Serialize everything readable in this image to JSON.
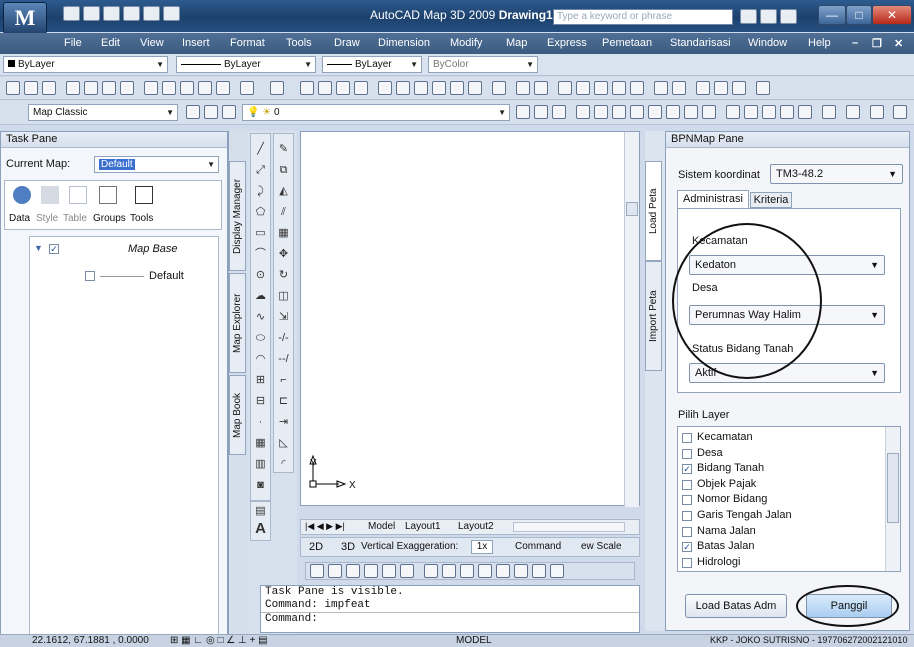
{
  "app": {
    "logo": "M",
    "title": "AutoCAD Map 3D 2009",
    "doc": "Drawing1.dwg",
    "search_placeholder": "Type a keyword or phrase"
  },
  "menu": [
    "File",
    "Edit",
    "View",
    "Insert",
    "Format",
    "Tools",
    "Draw",
    "Dimension",
    "Modify",
    "Map",
    "Express",
    "Pemetaan",
    "Standarisasi",
    "Window",
    "Help"
  ],
  "props": {
    "layer": "ByLayer",
    "linetype": "ByLayer",
    "lineweight": "ByLayer",
    "color": "ByColor"
  },
  "workspace": {
    "name": "Map Classic",
    "layer_current": "0"
  },
  "task_pane": {
    "title": "Task Pane",
    "current_map_label": "Current Map:",
    "current_map_value": "Default",
    "tools": [
      "Data",
      "Style",
      "Table",
      "Groups",
      "Tools"
    ],
    "tree_root": "Map Base",
    "tree_child": "Default",
    "side_tabs": [
      "Display Manager",
      "Map Explorer",
      "Map Book"
    ]
  },
  "layout_tabs": [
    "Model",
    "Layout1",
    "Layout2"
  ],
  "status_row": {
    "btn_2d": "2D",
    "btn_3d": "3D",
    "vert": "Vertical Exaggeration:",
    "vert_val": "1x",
    "command": "Command",
    "scale": "ew Scale"
  },
  "command_lines": [
    "Task Pane is visible.",
    "Command: impfeat",
    "Command:"
  ],
  "statusbar": {
    "coords": "22.1612, 67.1881 , 0.0000",
    "model": "MODEL",
    "user": "KKP - JOKO SUTRISNO - 197706272002121010"
  },
  "ucs": {
    "x": "X",
    "y": "Y"
  },
  "bpn": {
    "title": "BPNMap Pane",
    "side_tabs": [
      "Load Peta",
      "Import Peta"
    ],
    "sistem_label": "Sistem koordinat",
    "sistem_value": "TM3-48.2",
    "tabs": [
      "Administrasi",
      "Kriteria"
    ],
    "kecamatan_label": "Kecamatan",
    "kecamatan_value": "Kedaton",
    "desa_label": "Desa",
    "desa_value": "Perumnas Way Halim",
    "status_label": "Status Bidang Tanah",
    "status_value": "Aktif",
    "pilih_layer": "Pilih Layer",
    "layers": [
      {
        "name": "Kecamatan",
        "checked": false
      },
      {
        "name": "Desa",
        "checked": false
      },
      {
        "name": "Bidang Tanah",
        "checked": true
      },
      {
        "name": "Objek Pajak",
        "checked": false
      },
      {
        "name": "Nomor Bidang",
        "checked": false
      },
      {
        "name": "Garis Tengah Jalan",
        "checked": false
      },
      {
        "name": "Nama Jalan",
        "checked": false
      },
      {
        "name": "Batas Jalan",
        "checked": true
      },
      {
        "name": "Hidrologi",
        "checked": false
      }
    ],
    "btn_load": "Load Batas Adm",
    "btn_panggil": "Panggil"
  }
}
